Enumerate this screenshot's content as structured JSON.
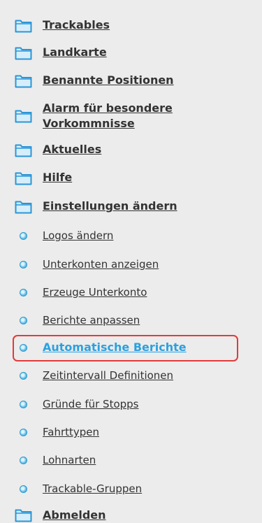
{
  "menu": {
    "folders": [
      {
        "label": "Trackables",
        "icon": "folder-icon"
      },
      {
        "label": "Landkarte",
        "icon": "folder-icon"
      },
      {
        "label": "Benannte Positionen",
        "icon": "folder-icon"
      },
      {
        "label": "Alarm für besondere",
        "label2": "Vorkommnisse",
        "icon": "folder-icon"
      },
      {
        "label": "Aktuelles",
        "icon": "folder-icon"
      },
      {
        "label": "Hilfe",
        "icon": "folder-icon"
      },
      {
        "label": "Einstellungen ändern",
        "icon": "folder-icon"
      }
    ],
    "subitems": [
      {
        "label": "Logos ändern"
      },
      {
        "label": "Unterkonten anzeigen"
      },
      {
        "label": "Erzeuge Unterkonto"
      },
      {
        "label": "Berichte anpassen"
      },
      {
        "label": "Automatische Berichte",
        "active": true
      },
      {
        "label": "Zeitintervall Definitionen"
      },
      {
        "label": "Gründe für Stopps"
      },
      {
        "label": "Fahrttypen"
      },
      {
        "label": "Lohnarten"
      },
      {
        "label": "Trackable-Gruppen"
      }
    ],
    "logout": {
      "label": "Abmelden",
      "icon": "folder-icon"
    }
  },
  "colors": {
    "background": "#ececec",
    "text": "#333333",
    "active_link": "#2aa1e0",
    "highlight_border": "#e23a3a",
    "folder_fill": "#d6eefc",
    "folder_stroke": "#2a96d6"
  }
}
